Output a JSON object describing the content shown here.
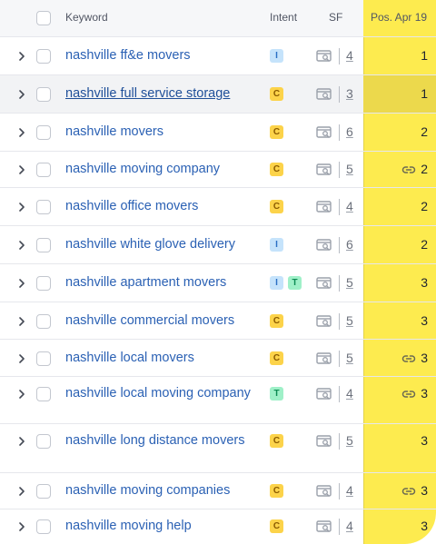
{
  "header": {
    "keyword_label": "Keyword",
    "intent_label": "Intent",
    "sf_label": "SF",
    "position_label": "Pos. Apr 19"
  },
  "rows": [
    {
      "keyword": "nashville ff&e movers",
      "intents": [
        "I"
      ],
      "sf": "4",
      "position": "1",
      "linked": false
    },
    {
      "keyword": "nashville full service storage",
      "intents": [
        "C"
      ],
      "sf": "3",
      "position": "1",
      "linked": false
    },
    {
      "keyword": "nashville movers",
      "intents": [
        "C"
      ],
      "sf": "6",
      "position": "2",
      "linked": false
    },
    {
      "keyword": "nashville moving company",
      "intents": [
        "C"
      ],
      "sf": "5",
      "position": "2",
      "linked": true
    },
    {
      "keyword": "nashville office movers",
      "intents": [
        "C"
      ],
      "sf": "4",
      "position": "2",
      "linked": false
    },
    {
      "keyword": "nashville white glove delivery",
      "intents": [
        "I"
      ],
      "sf": "6",
      "position": "2",
      "linked": false
    },
    {
      "keyword": "nashville apartment movers",
      "intents": [
        "I",
        "T"
      ],
      "sf": "5",
      "position": "3",
      "linked": false
    },
    {
      "keyword": "nashville commercial movers",
      "intents": [
        "C"
      ],
      "sf": "5",
      "position": "3",
      "linked": false
    },
    {
      "keyword": "nashville local movers",
      "intents": [
        "C"
      ],
      "sf": "5",
      "position": "3",
      "linked": true
    },
    {
      "keyword": "nashville local moving company",
      "intents": [
        "T"
      ],
      "sf": "4",
      "position": "3",
      "linked": true
    },
    {
      "keyword": "nashville long distance movers",
      "intents": [
        "C"
      ],
      "sf": "5",
      "position": "3",
      "linked": false
    },
    {
      "keyword": "nashville moving companies",
      "intents": [
        "C"
      ],
      "sf": "4",
      "position": "3",
      "linked": true
    },
    {
      "keyword": "nashville moving help",
      "intents": [
        "C"
      ],
      "sf": "4",
      "position": "3",
      "linked": false
    }
  ],
  "colors": {
    "position_column": "#fdeb4f",
    "keyword_link": "#2b61b4",
    "intent_informational": "#c5e3fb",
    "intent_commercial": "#fcd34a",
    "intent_transactional": "#9ff0c8"
  },
  "icons": {
    "expand": "chevron-right-icon",
    "serp": "serp-features-icon",
    "link": "link-icon"
  }
}
